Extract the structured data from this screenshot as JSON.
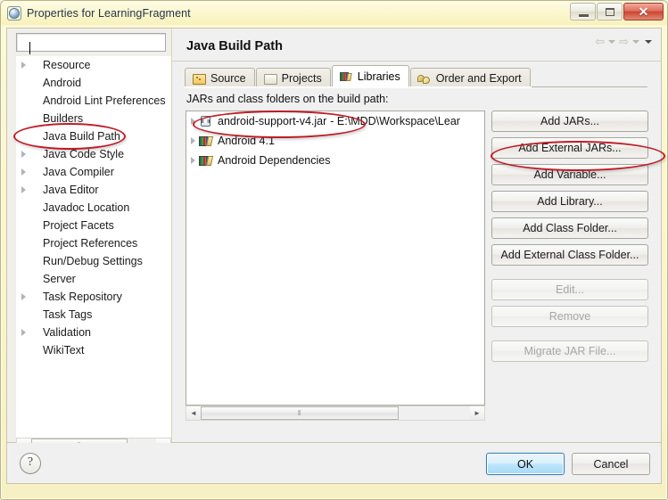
{
  "window": {
    "title": "Properties for LearningFragment",
    "icon": "eclipse-properties-icon",
    "minimize_label": "Minimize",
    "maximize_label": "Maximize",
    "close_label": "✕"
  },
  "sidebar": {
    "filter": {
      "value": "",
      "placeholder": ""
    },
    "items": [
      {
        "label": "Resource",
        "expandable": true
      },
      {
        "label": "Android",
        "expandable": false
      },
      {
        "label": "Android Lint Preferences",
        "expandable": false
      },
      {
        "label": "Builders",
        "expandable": false
      },
      {
        "label": "Java Build Path",
        "expandable": false
      },
      {
        "label": "Java Code Style",
        "expandable": true
      },
      {
        "label": "Java Compiler",
        "expandable": true
      },
      {
        "label": "Java Editor",
        "expandable": true
      },
      {
        "label": "Javadoc Location",
        "expandable": false
      },
      {
        "label": "Project Facets",
        "expandable": false
      },
      {
        "label": "Project References",
        "expandable": false
      },
      {
        "label": "Run/Debug Settings",
        "expandable": false
      },
      {
        "label": "Server",
        "expandable": false
      },
      {
        "label": "Task Repository",
        "expandable": true
      },
      {
        "label": "Task Tags",
        "expandable": false
      },
      {
        "label": "Validation",
        "expandable": true
      },
      {
        "label": "WikiText",
        "expandable": false
      }
    ]
  },
  "main": {
    "title": "Java Build Path",
    "tabs": [
      {
        "label": "Source",
        "icon": "source-folder-icon",
        "active": false
      },
      {
        "label": "Projects",
        "icon": "projects-folder-icon",
        "active": false
      },
      {
        "label": "Libraries",
        "icon": "libraries-books-icon",
        "active": true
      },
      {
        "label": "Order and Export",
        "icon": "order-export-icon",
        "active": false
      }
    ],
    "section_label": "JARs and class folders on the build path:",
    "entries": [
      {
        "name": "android-support-v4.jar",
        "path": "- E:\\MDD\\Workspace\\Lear",
        "icon": "jar-file-icon"
      },
      {
        "name": "Android 4.1",
        "path": "",
        "icon": "library-icon"
      },
      {
        "name": "Android Dependencies",
        "path": "",
        "icon": "library-icon"
      }
    ],
    "buttons": [
      {
        "label": "Add JARs...",
        "disabled": false
      },
      {
        "label": "Add External JARs...",
        "disabled": false
      },
      {
        "label": "Add Variable...",
        "disabled": false
      },
      {
        "label": "Add Library...",
        "disabled": false
      },
      {
        "label": "Add Class Folder...",
        "disabled": false
      },
      {
        "label": "Add External Class Folder...",
        "disabled": false
      },
      {
        "label": "Edit...",
        "disabled": true
      },
      {
        "label": "Remove",
        "disabled": true
      },
      {
        "label": "Migrate JAR File...",
        "disabled": true
      }
    ]
  },
  "footer": {
    "help_label": "?",
    "ok_label": "OK",
    "cancel_label": "Cancel"
  },
  "annotations": {
    "color": "#bf1b26",
    "targets": [
      "Java Build Path",
      "android-support-v4.jar",
      "Add External JARs..."
    ]
  },
  "scrollbars": {
    "left_marker": "‖",
    "right_marker": "‖",
    "left_arrow": "◄",
    "right_arrow": "►"
  }
}
